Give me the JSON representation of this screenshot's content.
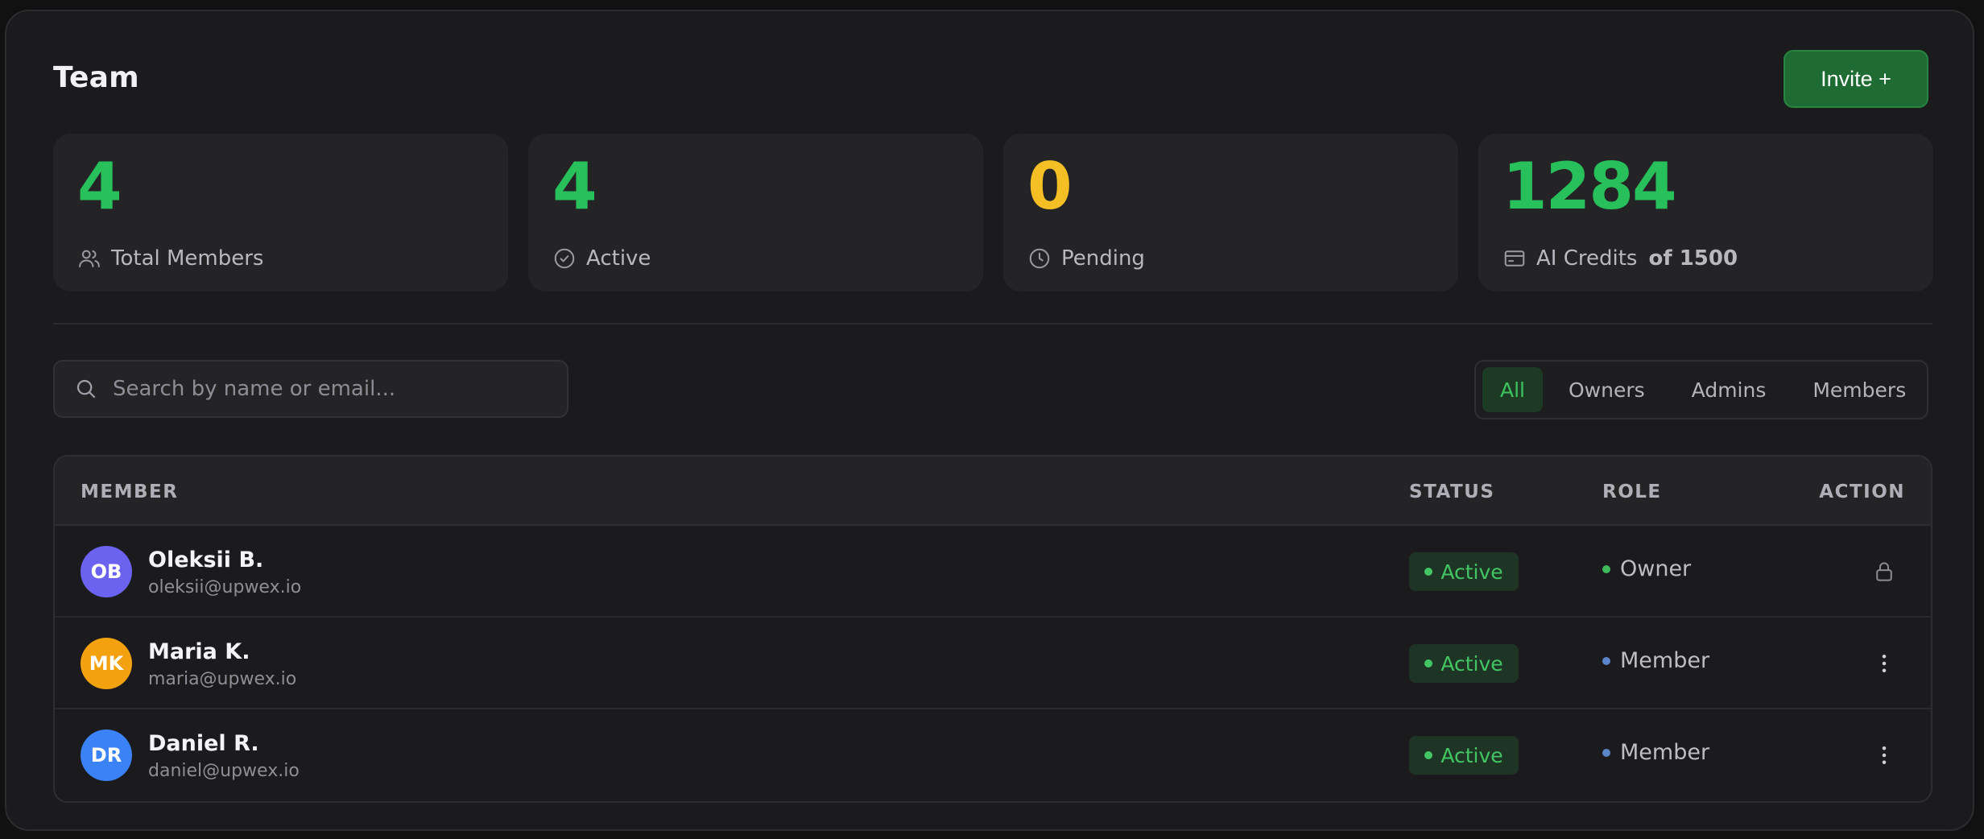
{
  "header": {
    "title": "Team",
    "invite_label": "Invite +"
  },
  "stats": [
    {
      "value": "4",
      "label": "Total Members",
      "sub": "",
      "icon": "users-icon",
      "color": "#27c05a"
    },
    {
      "value": "4",
      "label": "Active",
      "sub": "",
      "icon": "check-circle-icon",
      "color": "#27c05a"
    },
    {
      "value": "0",
      "label": "Pending",
      "sub": "",
      "icon": "clock-icon",
      "color": "#f4bf24"
    },
    {
      "value": "1284",
      "label": "AI Credits",
      "sub": "of 1500",
      "icon": "credit-card-icon",
      "color": "#27c05a"
    }
  ],
  "search": {
    "placeholder": "Search by name or email..."
  },
  "filters": {
    "tabs": [
      "All",
      "Owners",
      "Admins",
      "Members"
    ],
    "selected": "All"
  },
  "table": {
    "columns": {
      "member": "MEMBER",
      "status": "STATUS",
      "role": "ROLE",
      "action": "ACTION"
    },
    "rows": [
      {
        "initials": "OB",
        "name": "Oleksii B.",
        "email": "oleksii@upwex.io",
        "status": "Active",
        "role": "Owner",
        "action_icon": "lock-icon",
        "avatar_color": "#6b63f0",
        "role_color": "#3db85a"
      },
      {
        "initials": "MK",
        "name": "Maria K.",
        "email": "maria@upwex.io",
        "status": "Active",
        "role": "Member",
        "action_icon": "more-vertical-icon",
        "avatar_color": "#f3a10f",
        "role_color": "#5b86c9"
      },
      {
        "initials": "DR",
        "name": "Daniel R.",
        "email": "daniel@upwex.io",
        "status": "Active",
        "role": "Member",
        "action_icon": "more-vertical-icon",
        "avatar_color": "#3b82f6",
        "role_color": "#5b86c9"
      }
    ]
  },
  "colors": {
    "accent_green": "#27c05a",
    "pending_yellow": "#f4bf24",
    "status_active": "#42c663"
  }
}
